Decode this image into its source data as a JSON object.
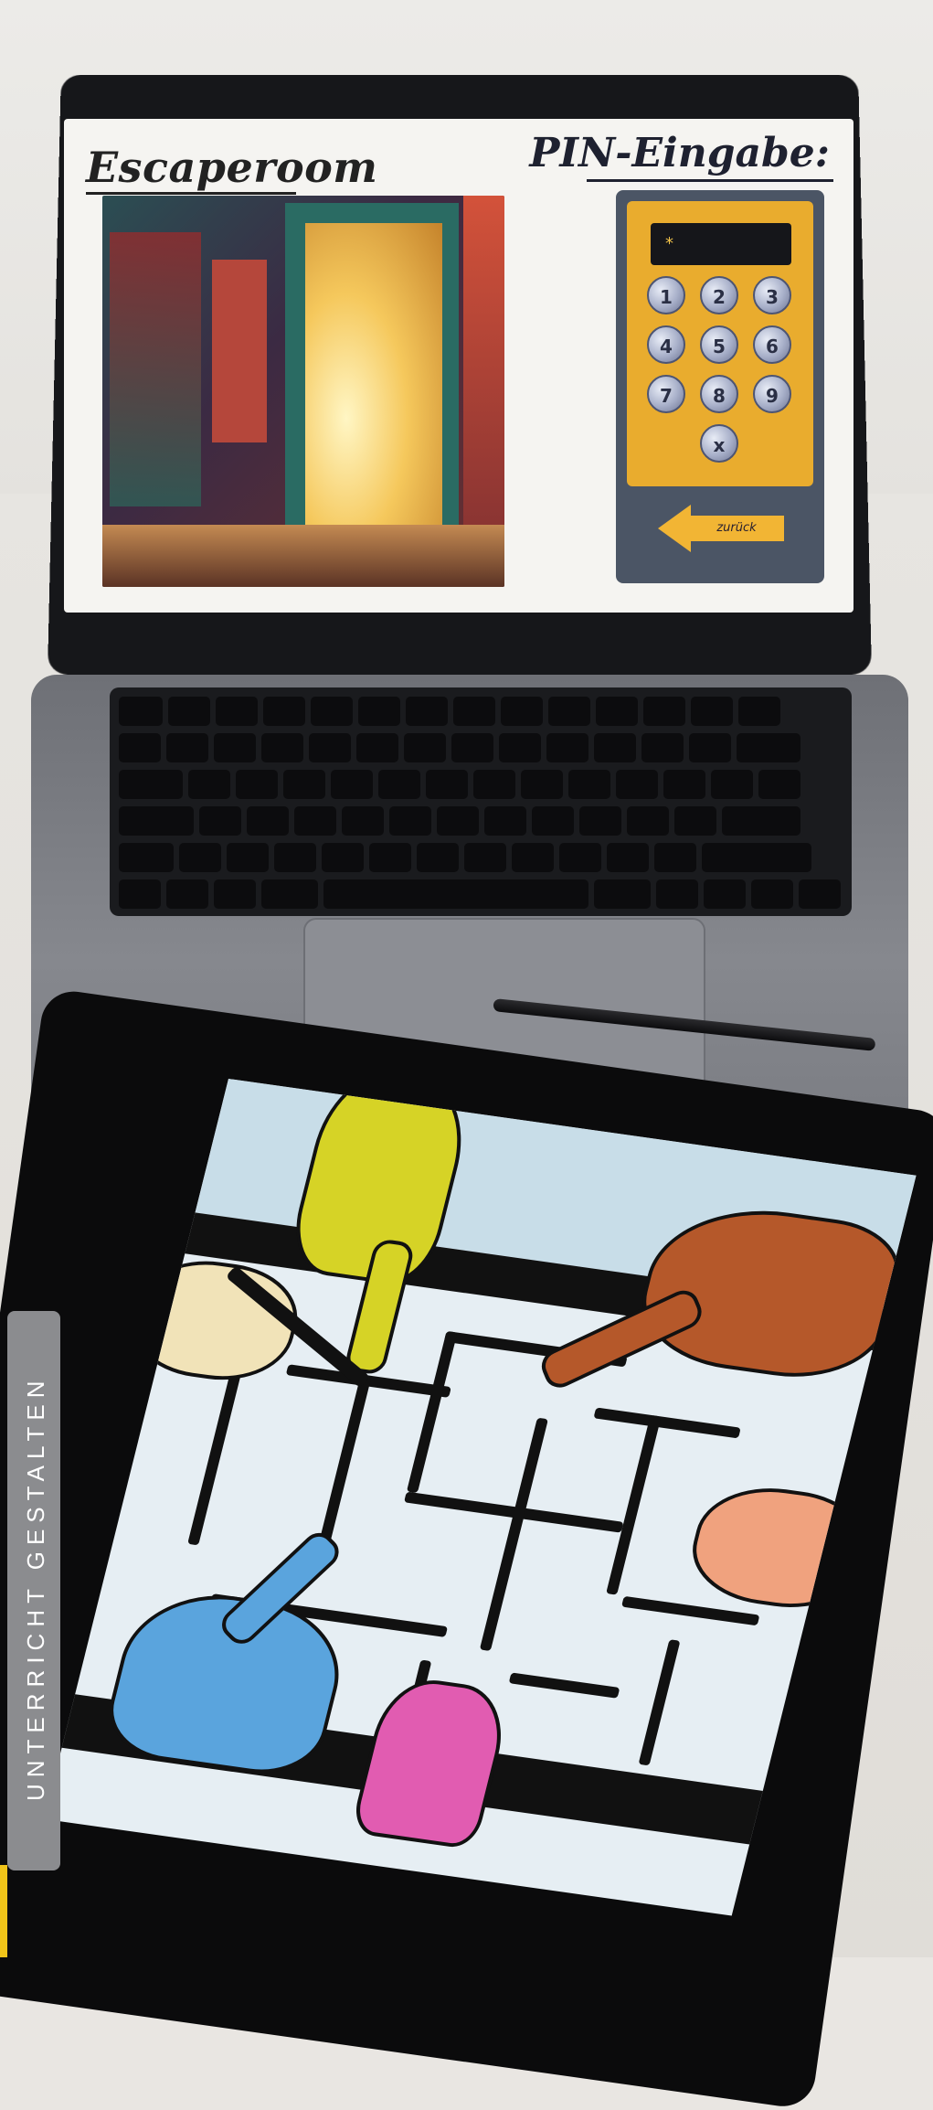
{
  "laptop_screen": {
    "title": "Escaperoom",
    "pin_title": "PIN-Eingabe:",
    "display_value": "*",
    "keys": [
      "1",
      "2",
      "3",
      "4",
      "5",
      "6",
      "7",
      "8",
      "9",
      "x"
    ],
    "back_label": "zurück"
  },
  "side_label": "UNTERRICHT GESTALTEN",
  "colors": {
    "keypad_body": "#e9ac2e",
    "keypad_frame": "#4b5565",
    "side_tab": "#8b8c8f",
    "accent": "#f0c419"
  }
}
